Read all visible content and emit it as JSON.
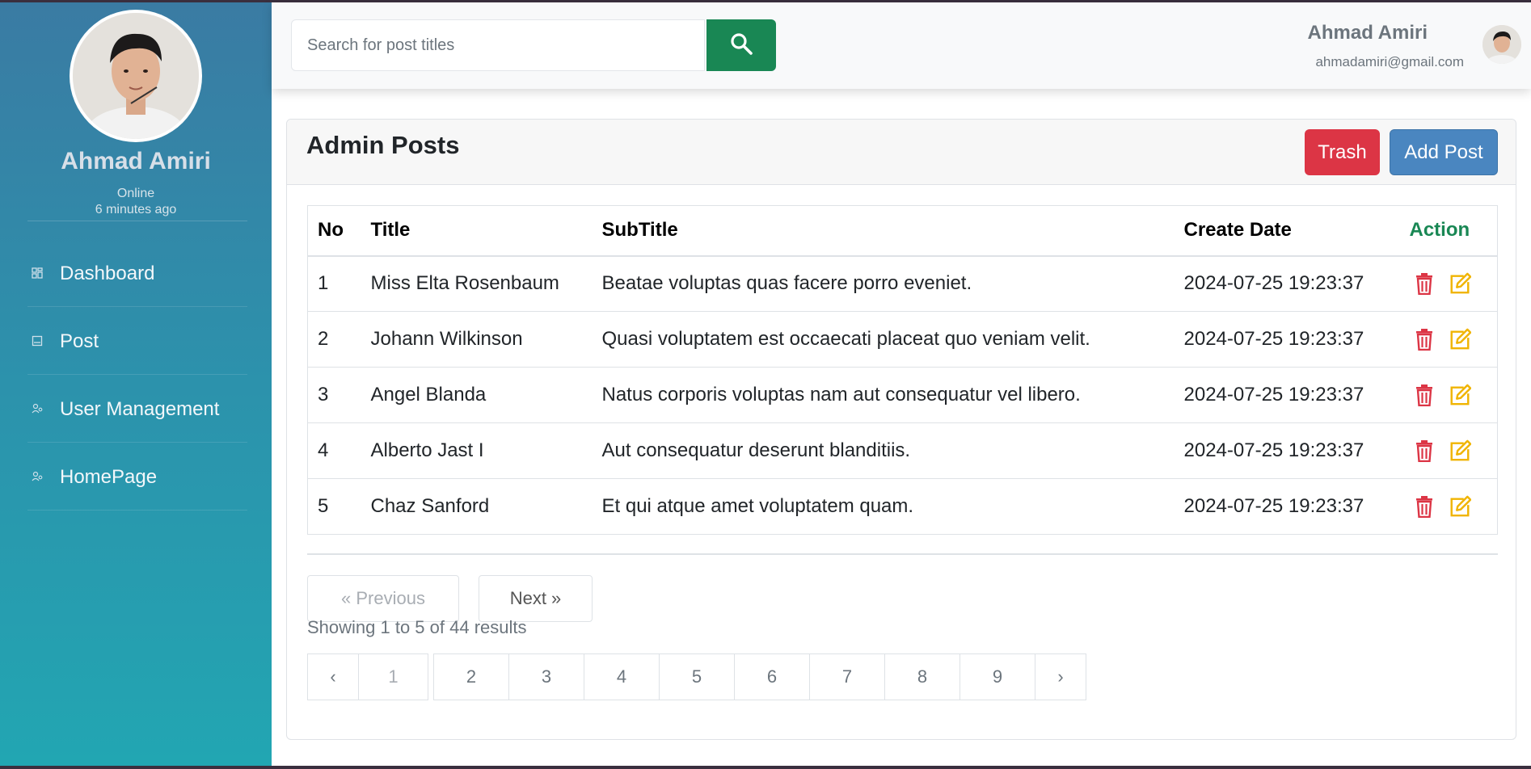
{
  "sidebar": {
    "name": "Ahmad Amiri",
    "status": "Online",
    "last_seen": "6 minutes ago",
    "items": [
      {
        "label": "Dashboard",
        "icon": "dashboard-icon"
      },
      {
        "label": "Post",
        "icon": "post-icon"
      },
      {
        "label": "User Management",
        "icon": "users-icon"
      },
      {
        "label": "HomePage",
        "icon": "home-users-icon"
      }
    ]
  },
  "topbar": {
    "search_placeholder": "Search for post titles",
    "search_icon": "search-icon",
    "user_name": "Ahmad Amiri",
    "user_email": "ahmadamiri@gmail.com"
  },
  "page": {
    "title": "Admin Posts",
    "trash_label": "Trash",
    "add_label": "Add Post"
  },
  "table": {
    "headers": {
      "no": "No",
      "title": "Title",
      "subtitle": "SubTitle",
      "date": "Create Date",
      "action": "Action"
    },
    "rows": [
      {
        "no": "1",
        "title": "Miss Elta Rosenbaum",
        "subtitle": "Beatae voluptas quas facere porro eveniet.",
        "date": "2024-07-25 19:23:37"
      },
      {
        "no": "2",
        "title": "Johann Wilkinson",
        "subtitle": "Quasi voluptatem est occaecati placeat quo veniam velit.",
        "date": "2024-07-25 19:23:37"
      },
      {
        "no": "3",
        "title": "Angel Blanda",
        "subtitle": "Natus corporis voluptas nam aut consequatur vel libero.",
        "date": "2024-07-25 19:23:37"
      },
      {
        "no": "4",
        "title": "Alberto Jast I",
        "subtitle": "Aut consequatur deserunt blanditiis.",
        "date": "2024-07-25 19:23:37"
      },
      {
        "no": "5",
        "title": "Chaz Sanford",
        "subtitle": "Et qui atque amet voluptatem quam.",
        "date": "2024-07-25 19:23:37"
      }
    ]
  },
  "pagination": {
    "previous": "« Previous",
    "next": "Next »",
    "showing": "Showing 1 to 5 of 44 results",
    "prev_arrow": "‹",
    "next_arrow": "›",
    "pages": [
      "1",
      "2",
      "3",
      "4",
      "5",
      "6",
      "7",
      "8",
      "9"
    ],
    "current_page": "1"
  },
  "colors": {
    "sidebar_top": "#3a7ba3",
    "sidebar_bottom": "#22a6b2",
    "search_button": "#198754",
    "trash": "#dc3545",
    "add": "#4a86c0",
    "action_header": "#198754",
    "delete_icon": "#dc3545",
    "edit_icon": "#f0b400"
  }
}
